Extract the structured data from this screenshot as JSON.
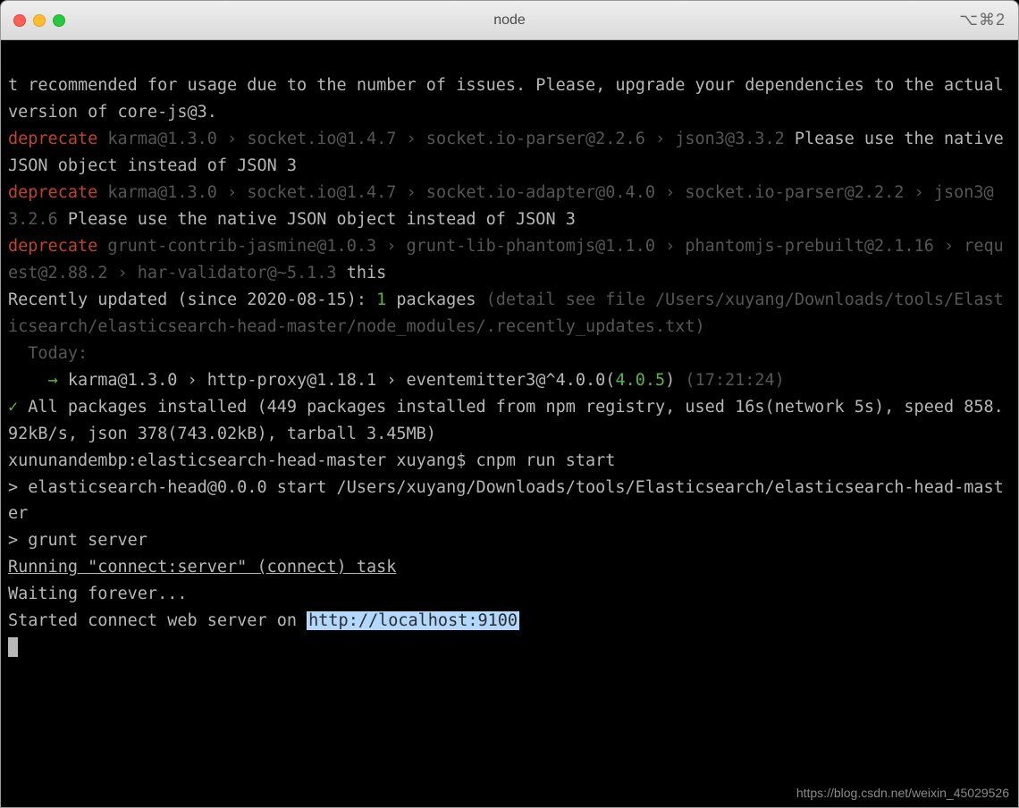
{
  "titlebar": {
    "title": "node",
    "shortcut": "⌥⌘2"
  },
  "terminal": {
    "lines": {
      "l0": "t recommended for usage due to the number of issues. Please, upgrade your dependencies to the actual version of core-js@3.",
      "l1_a": "deprecate",
      "l1_b": " karma@1.3.0 › socket.io@1.4.7 › socket.io-parser@2.2.6 › json3@3.3.2 ",
      "l1_c": "Please use the native JSON object instead of JSON 3",
      "l2_a": "deprecate",
      "l2_b": " karma@1.3.0 › socket.io@1.4.7 › socket.io-adapter@0.4.0 › socket.io-parser@2.2.2 › json3@3.2.6 ",
      "l2_c": "Please use the native JSON object instead of JSON 3",
      "l3_a": "deprecate",
      "l3_b": " grunt-contrib-jasmine@1.0.3 › grunt-lib-phantomjs@1.1.0 › phantomjs-prebuilt@2.1.16 › request@2.88.2 › har-validator@~5.1.3 ",
      "l3_c": "this",
      "l4_a": "Recently updated (since 2020-08-15): ",
      "l4_b": "1",
      "l4_c": " packages ",
      "l4_d": "(detail see file /Users/xuyang/Downloads/tools/Elasticsearch/elasticsearch-head-master/node_modules/.recently_updates.txt)",
      "l5": "  Today:",
      "l6_a": "    →",
      "l6_b": " karma@1.3.0 › http-proxy@1.18.1 › eventemitter3@^4.0.0(",
      "l6_c": "4.0.5",
      "l6_d": ") ",
      "l6_e": "(17:21:24)",
      "l7_a": "✓",
      "l7_b": " All packages installed (449 packages installed from npm registry, used 16s(network 5s), speed 858.92kB/s, json 378(743.02kB), tarball 3.45MB)",
      "l8": "xununandembp:elasticsearch-head-master xuyang$ cnpm run start",
      "l9": "",
      "l10": "> elasticsearch-head@0.0.0 start /Users/xuyang/Downloads/tools/Elasticsearch/elasticsearch-head-master",
      "l11": "> grunt server",
      "l12": "",
      "l13": "Running \"connect:server\" (connect) task",
      "l14": "Waiting forever...",
      "l15_a": "Started connect web server on ",
      "l15_b": "http://localhost:9100"
    }
  },
  "watermark": "https://blog.csdn.net/weixin_45029526"
}
